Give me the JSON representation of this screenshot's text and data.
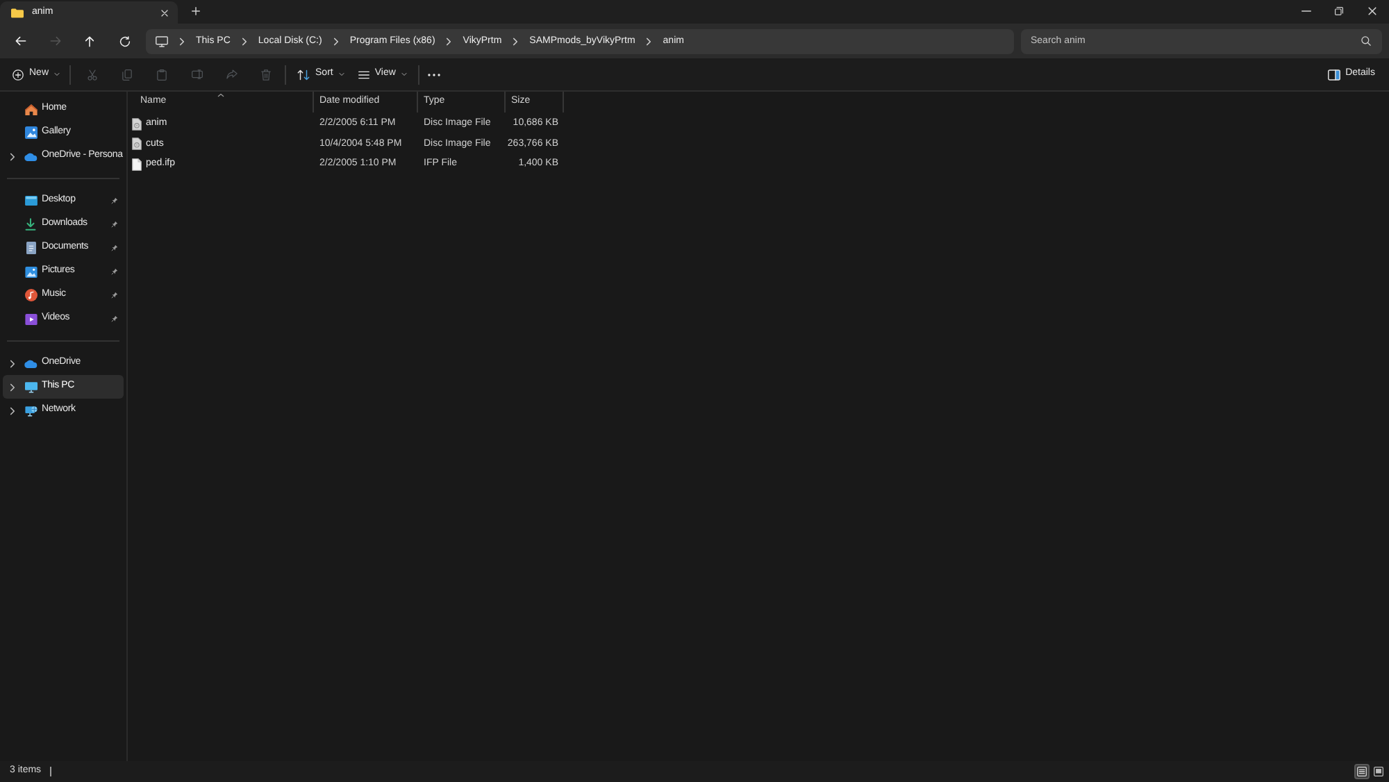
{
  "tabs": [
    {
      "title": "anim",
      "selected": true
    }
  ],
  "navigation": [
    {
      "kind": "back",
      "disabled": false
    },
    {
      "kind": "forward",
      "disabled": true
    },
    {
      "kind": "up",
      "disabled": false
    },
    {
      "kind": "refresh",
      "disabled": false
    }
  ],
  "address_bar": {
    "crumbs": [
      "This PC",
      "Local Disk (C:)",
      "Program Files (x86)",
      "VikyPrtm",
      "SAMPmods_byVikyPrtm",
      "anim"
    ]
  },
  "search": {
    "placeholder": "Search anim"
  },
  "command_bar": {
    "new": "New",
    "actions": [
      {
        "kind": "cut",
        "disabled": true
      },
      {
        "kind": "copy",
        "disabled": true
      },
      {
        "kind": "paste",
        "disabled": true
      },
      {
        "kind": "rename",
        "disabled": true
      },
      {
        "kind": "share",
        "disabled": true
      },
      {
        "kind": "delete",
        "disabled": true
      }
    ],
    "sort": "Sort",
    "view": "View",
    "details": "Details"
  },
  "sidebar": {
    "groups": [
      {
        "items": [
          {
            "label": "Home",
            "kind": "home",
            "selected": false,
            "pinned": false,
            "expandable": false
          },
          {
            "label": "Gallery",
            "kind": "gallery",
            "selected": false,
            "pinned": false,
            "expandable": false
          },
          {
            "label": "OneDrive - Persona",
            "kind": "cloud",
            "selected": false,
            "pinned": false,
            "expandable": true
          }
        ]
      },
      {
        "items": [
          {
            "label": "Desktop",
            "kind": "desktop",
            "selected": false,
            "pinned": true,
            "expandable": false
          },
          {
            "label": "Downloads",
            "kind": "downloads",
            "selected": false,
            "pinned": true,
            "expandable": false
          },
          {
            "label": "Documents",
            "kind": "documents",
            "selected": false,
            "pinned": true,
            "expandable": false
          },
          {
            "label": "Pictures",
            "kind": "pictures",
            "selected": false,
            "pinned": true,
            "expandable": false
          },
          {
            "label": "Music",
            "kind": "music",
            "selected": false,
            "pinned": true,
            "expandable": false
          },
          {
            "label": "Videos",
            "kind": "videos",
            "selected": false,
            "pinned": true,
            "expandable": false
          }
        ]
      },
      {
        "items": [
          {
            "label": "OneDrive",
            "kind": "cloud",
            "selected": false,
            "pinned": false,
            "expandable": true
          },
          {
            "label": "This PC",
            "kind": "pc",
            "selected": true,
            "pinned": false,
            "expandable": true
          },
          {
            "label": "Network",
            "kind": "network",
            "selected": false,
            "pinned": false,
            "expandable": true
          }
        ]
      }
    ]
  },
  "table": {
    "columns": [
      {
        "label": "Name",
        "sorted": true
      },
      {
        "label": "Date modified",
        "sorted": false
      },
      {
        "label": "Type",
        "sorted": false
      },
      {
        "label": "Size",
        "sorted": false
      }
    ],
    "rows": [
      {
        "kind": "disc_image",
        "name": "anim",
        "date": "2/2/2005 6:11 PM",
        "type": "Disc Image File",
        "size": "10,686 KB"
      },
      {
        "kind": "disc_image",
        "name": "cuts",
        "date": "10/4/2004 5:48 PM",
        "type": "Disc Image File",
        "size": "263,766 KB"
      },
      {
        "kind": "file",
        "name": "ped.ifp",
        "date": "2/2/2005 1:10 PM",
        "type": "IFP File",
        "size": "1,400 KB"
      }
    ]
  },
  "status_bar": {
    "item_count": "3 items",
    "views": [
      {
        "kind": "details",
        "selected": true
      },
      {
        "kind": "tiles",
        "selected": false
      }
    ]
  }
}
